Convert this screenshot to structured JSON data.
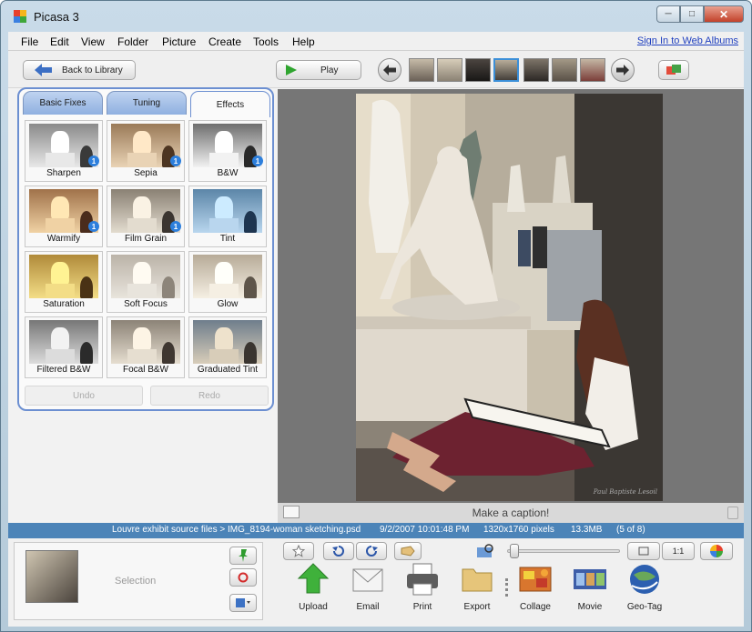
{
  "window": {
    "title": "Picasa 3"
  },
  "menu": {
    "items": [
      "File",
      "Edit",
      "View",
      "Folder",
      "Picture",
      "Create",
      "Tools",
      "Help"
    ],
    "signin": "Sign In to Web Albums"
  },
  "toolbar": {
    "back_label": "Back to Library",
    "play_label": "Play"
  },
  "edit_panel": {
    "tabs": [
      "Basic Fixes",
      "Tuning",
      "Effects"
    ],
    "active_tab": "Effects",
    "effects": [
      {
        "label": "Sharpen",
        "badge": "1"
      },
      {
        "label": "Sepia",
        "badge": "1"
      },
      {
        "label": "B&W",
        "badge": "1"
      },
      {
        "label": "Warmify",
        "badge": "1"
      },
      {
        "label": "Film Grain",
        "badge": "1"
      },
      {
        "label": "Tint",
        "badge": ""
      },
      {
        "label": "Saturation",
        "badge": ""
      },
      {
        "label": "Soft Focus",
        "badge": ""
      },
      {
        "label": "Glow",
        "badge": ""
      },
      {
        "label": "Filtered B&W",
        "badge": ""
      },
      {
        "label": "Focal B&W",
        "badge": ""
      },
      {
        "label": "Graduated Tint",
        "badge": ""
      }
    ],
    "undo_label": "Undo",
    "redo_label": "Redo"
  },
  "viewer": {
    "caption_placeholder": "Make a caption!",
    "watermark": "Paul Baptiste Lesoil"
  },
  "status": {
    "path": "Louvre exhibit source files > IMG_8194-woman sketching.psd",
    "datetime": "9/2/2007 10:01:48 PM",
    "dimensions": "1320x1760 pixels",
    "filesize": "13.3MB",
    "position": "(5 of 8)"
  },
  "tray": {
    "selection_label": "Selection"
  },
  "zoom": {
    "level": 0.02,
    "fit_label": "1:1"
  },
  "actions": [
    "Upload",
    "Email",
    "Print",
    "Export",
    "Collage",
    "Movie",
    "Geo-Tag"
  ],
  "colors": {
    "accent": "#4c84b8",
    "tab_border": "#6c8fd1",
    "play_green": "#2fa52f",
    "badge_blue": "#2d7fdc"
  },
  "icons": {
    "back": "arrow-left-icon",
    "play": "play-triangle-icon",
    "prev": "arrow-left-circle-icon",
    "next": "arrow-right-circle-icon",
    "star": "star-icon",
    "rotate_left": "rotate-ccw-icon",
    "rotate_right": "rotate-cw-icon",
    "tag": "tag-icon"
  }
}
